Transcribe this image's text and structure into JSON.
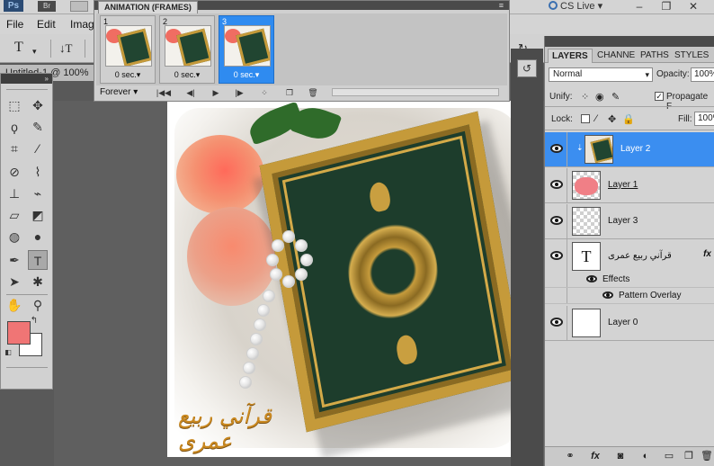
{
  "app": {
    "logo": "Ps",
    "bridge": "Br",
    "cs_live": "CS Live",
    "cs_live_arrow": "▾"
  },
  "menu": {
    "file": "File",
    "edit": "Edit",
    "image": "Imag"
  },
  "doc_tab": "Untitled-1 @ 100%",
  "animation": {
    "title": "ANIMATION (FRAMES)",
    "frames": [
      {
        "num": "1",
        "delay": "0 sec.▾"
      },
      {
        "num": "2",
        "delay": "0 sec.▾"
      },
      {
        "num": "3",
        "delay": "0 sec.▾"
      }
    ],
    "loop": "Forever"
  },
  "layers_panel": {
    "tabs": {
      "layers": "LAYERS",
      "channels": "CHANNE",
      "paths": "PATHS",
      "styles": "STYLES"
    },
    "blend_mode": "Normal",
    "opacity_label": "Opacity:",
    "opacity_value": "100%",
    "unify_label": "Unify:",
    "propagate_label": "Propagate F",
    "lock_label": "Lock:",
    "fill_label": "Fill:",
    "fill_value": "100%",
    "layers": [
      {
        "name": "Layer 2",
        "selected": true
      },
      {
        "name": "Layer 1"
      },
      {
        "name": "Layer 3"
      },
      {
        "name": "قرآني ربيع عمرى",
        "fx": "fx"
      },
      {
        "name": "Layer 0"
      }
    ],
    "effects_label": "Effects",
    "pattern_overlay_label": "Pattern Overlay"
  },
  "canvas": {
    "caption": "قرآني ربيع عمرى"
  },
  "colors": {
    "foreground": "#f07575",
    "background": "#ffffff",
    "selection": "#3b8ef0"
  }
}
